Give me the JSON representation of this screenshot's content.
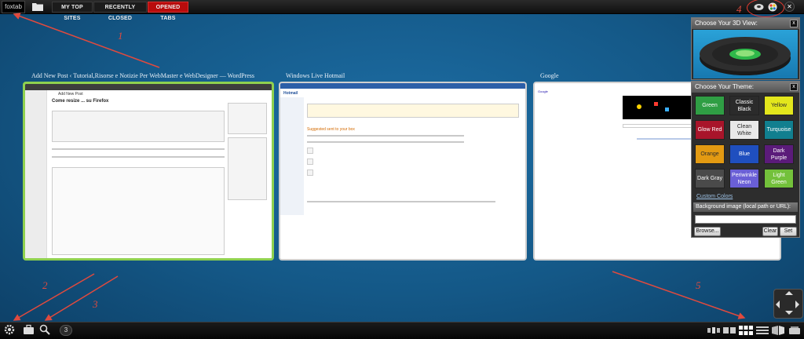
{
  "topbar": {
    "logo_text": "foxtab",
    "tabs": [
      {
        "label": "MY TOP SITES"
      },
      {
        "label": "RECENTLY CLOSED"
      },
      {
        "label": "OPENED TABS"
      }
    ],
    "close_symbol": "✕"
  },
  "annotations": [
    "1",
    "2",
    "3",
    "4",
    "5"
  ],
  "thumbnails": [
    {
      "title": "Add New Post ‹ Tutorial,Risorse e Notizie Per WebMaster e WebDesigner — WordPress",
      "selected": true,
      "page_heading": "Come resize ... su Firefox",
      "header_text": "Add New Post"
    },
    {
      "title": "Windows Live Hotmail",
      "selected": false,
      "page_heading": "Hotmail",
      "sub_heading": "Suggested sent to your box"
    },
    {
      "title": "Google",
      "selected": false,
      "page_heading": "Google"
    }
  ],
  "view_panel": {
    "title": "Choose Your 3D View:",
    "close": "x"
  },
  "theme_panel": {
    "title": "Choose Your Theme:",
    "close": "x",
    "themes": [
      {
        "label": "Green",
        "color": "#2f9e44",
        "text": "#ffffff"
      },
      {
        "label": "Classic Black",
        "color": "#2b2b2b",
        "text": "#ffffff"
      },
      {
        "label": "Yellow",
        "color": "#e3e61c",
        "text": "#2b2b2b"
      },
      {
        "label": "Glow Red",
        "color": "#a8142a",
        "text": "#ffffff"
      },
      {
        "label": "Clean White",
        "color": "#e9e9e9",
        "text": "#2b2b2b"
      },
      {
        "label": "Turquoise",
        "color": "#117f8f",
        "text": "#ffffff"
      },
      {
        "label": "Orange",
        "color": "#e39a12",
        "text": "#2b2b2b"
      },
      {
        "label": "Blue",
        "color": "#1f4fbf",
        "text": "#ffffff"
      },
      {
        "label": "Dark Purple",
        "color": "#5b1b7a",
        "text": "#ffffff"
      },
      {
        "label": "Dark Gray",
        "color": "#4a4a4a",
        "text": "#ffffff"
      },
      {
        "label": "Periwinkle Neon",
        "color": "#6a5fd6",
        "text": "#ffffff"
      },
      {
        "label": "Light Green",
        "color": "#73c13b",
        "text": "#ffffff"
      }
    ],
    "custom_colors_label": "Custom Colors",
    "background_label": "Background image (local path or URL):",
    "background_value": "",
    "browse_label": "Browse...",
    "clear_label": "Clear",
    "set_label": "Set"
  },
  "bottombar": {
    "tab_count": "3"
  },
  "colors": {
    "accent_red": "#b80c0c",
    "annotation_red": "#e04a3e",
    "selected_border": "#8fd14f"
  }
}
